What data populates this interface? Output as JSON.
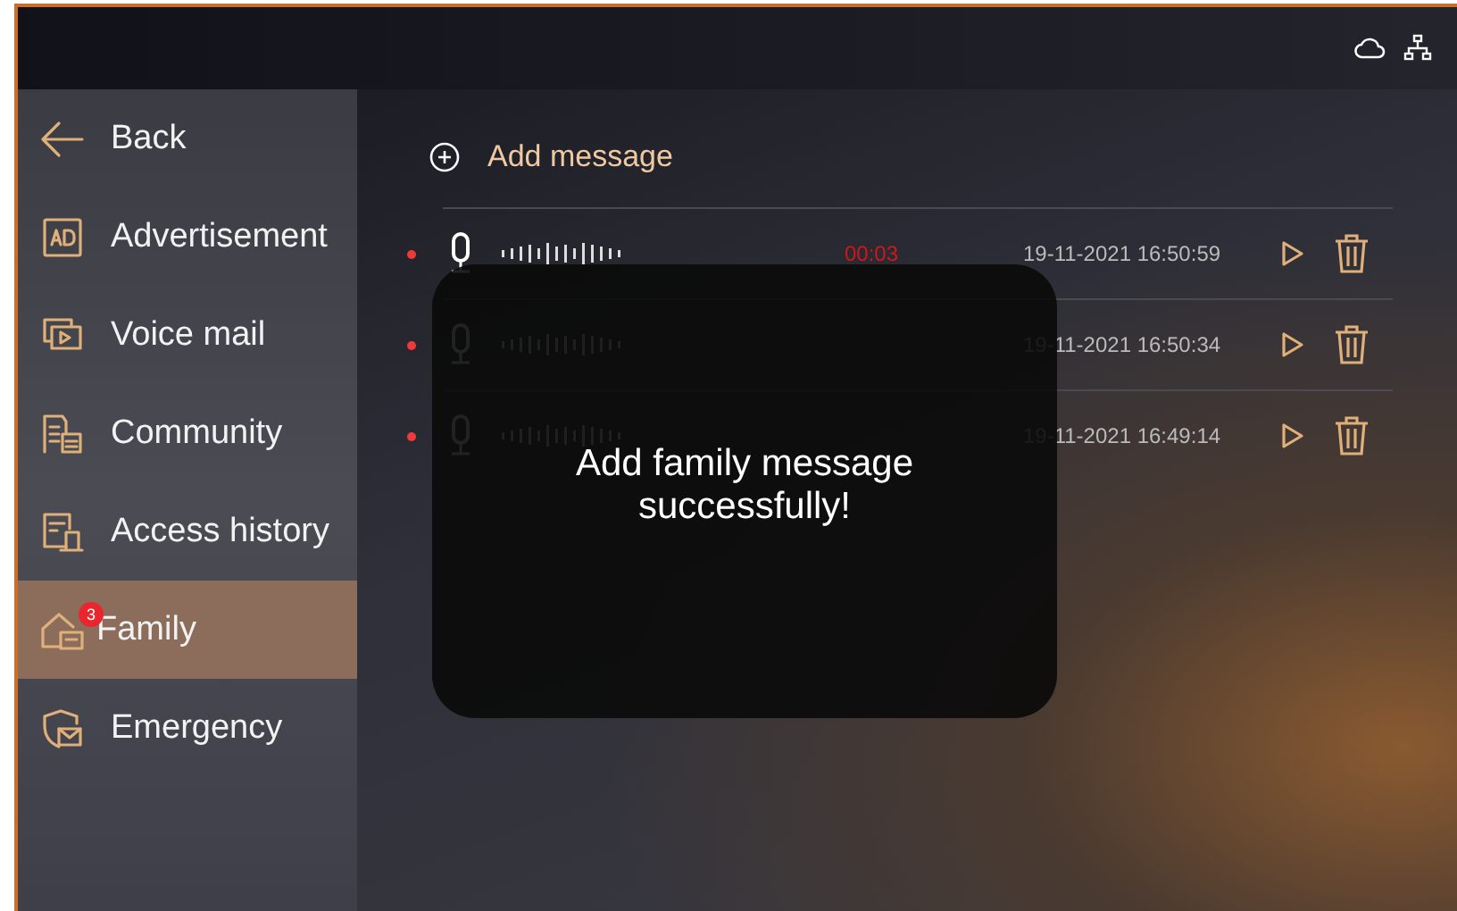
{
  "sidebar": {
    "items": [
      {
        "kind": "back",
        "label": "Back",
        "selected": false
      },
      {
        "kind": "ad",
        "label": "Advertisement",
        "selected": false
      },
      {
        "kind": "voicemail",
        "label": "Voice mail",
        "selected": false
      },
      {
        "kind": "community",
        "label": "Community",
        "selected": false
      },
      {
        "kind": "access",
        "label": "Access history",
        "selected": false
      },
      {
        "kind": "family",
        "label": "Family",
        "selected": true,
        "badge": "3"
      },
      {
        "kind": "emergency",
        "label": "Emergency",
        "selected": false
      }
    ]
  },
  "add_button": {
    "label": "Add message"
  },
  "messages": [
    {
      "unread": true,
      "duration": "00:03",
      "timestamp": "19-11-2021 16:50:59"
    },
    {
      "unread": true,
      "timestamp": "19-11-2021 16:50:34"
    },
    {
      "unread": true,
      "timestamp": "19-11-2021 16:49:14"
    }
  ],
  "toast": {
    "text": "Add family message successfully!"
  }
}
